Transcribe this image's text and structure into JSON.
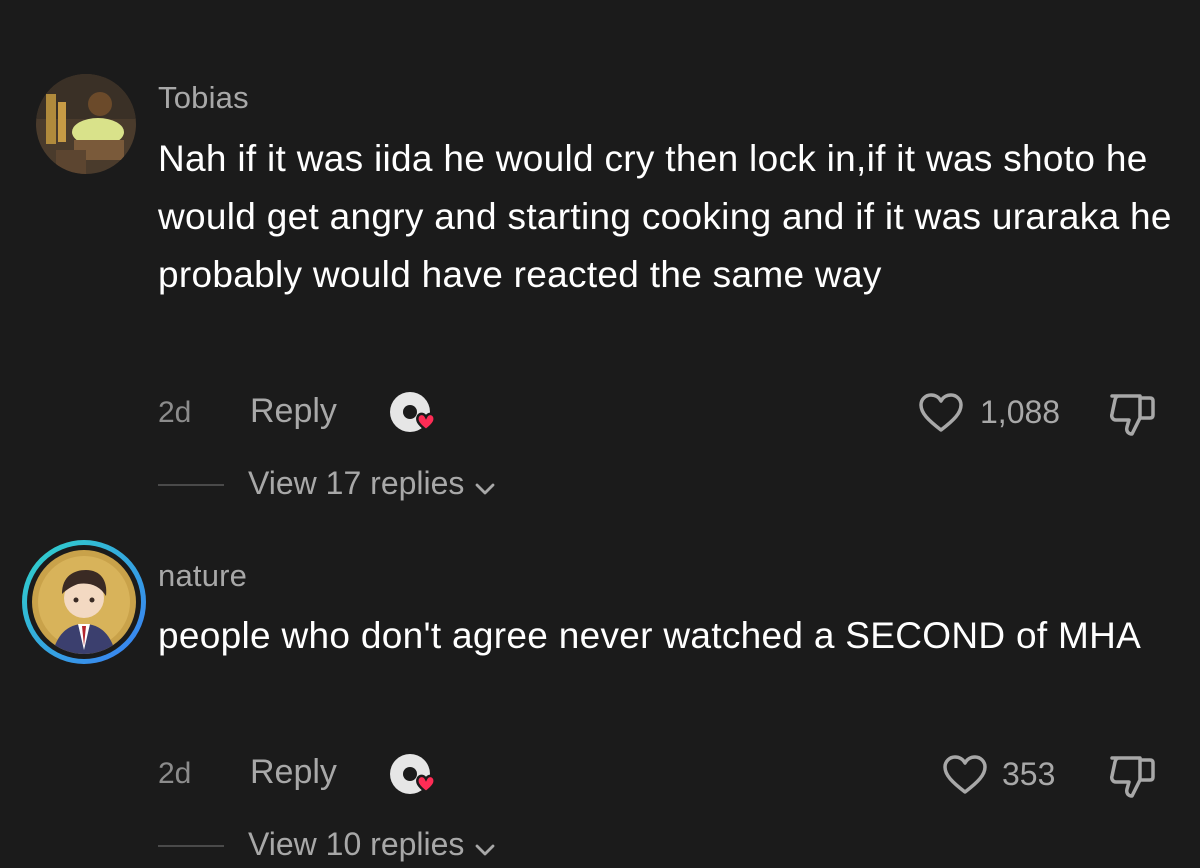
{
  "comments": [
    {
      "username": "Tobias",
      "text": "Nah if it was iida he would cry then lock in,if it was shoto he would get angry and starting cooking and if it was uraraka he probably would have reacted the same way",
      "age": "2d",
      "reply_label": "Reply",
      "like_count": "1,088",
      "view_replies_label": "View 17 replies"
    },
    {
      "username": "nature",
      "text": "people who don't agree never watched a SECOND of MHA",
      "age": "2d",
      "reply_label": "Reply",
      "like_count": "353",
      "view_replies_label": "View 10 replies"
    }
  ],
  "icons": {
    "like": "heart-outline-icon",
    "dislike": "thumbs-down-icon",
    "react": "creator-reaction-icon",
    "expand": "chevron-down-icon"
  },
  "colors": {
    "background": "#1b1b1b",
    "secondary_text": "#a8a8a8",
    "reaction_heart": "#fe2c55",
    "story_ring_start": "#2fd6c8",
    "story_ring_end": "#3a7bf5"
  }
}
